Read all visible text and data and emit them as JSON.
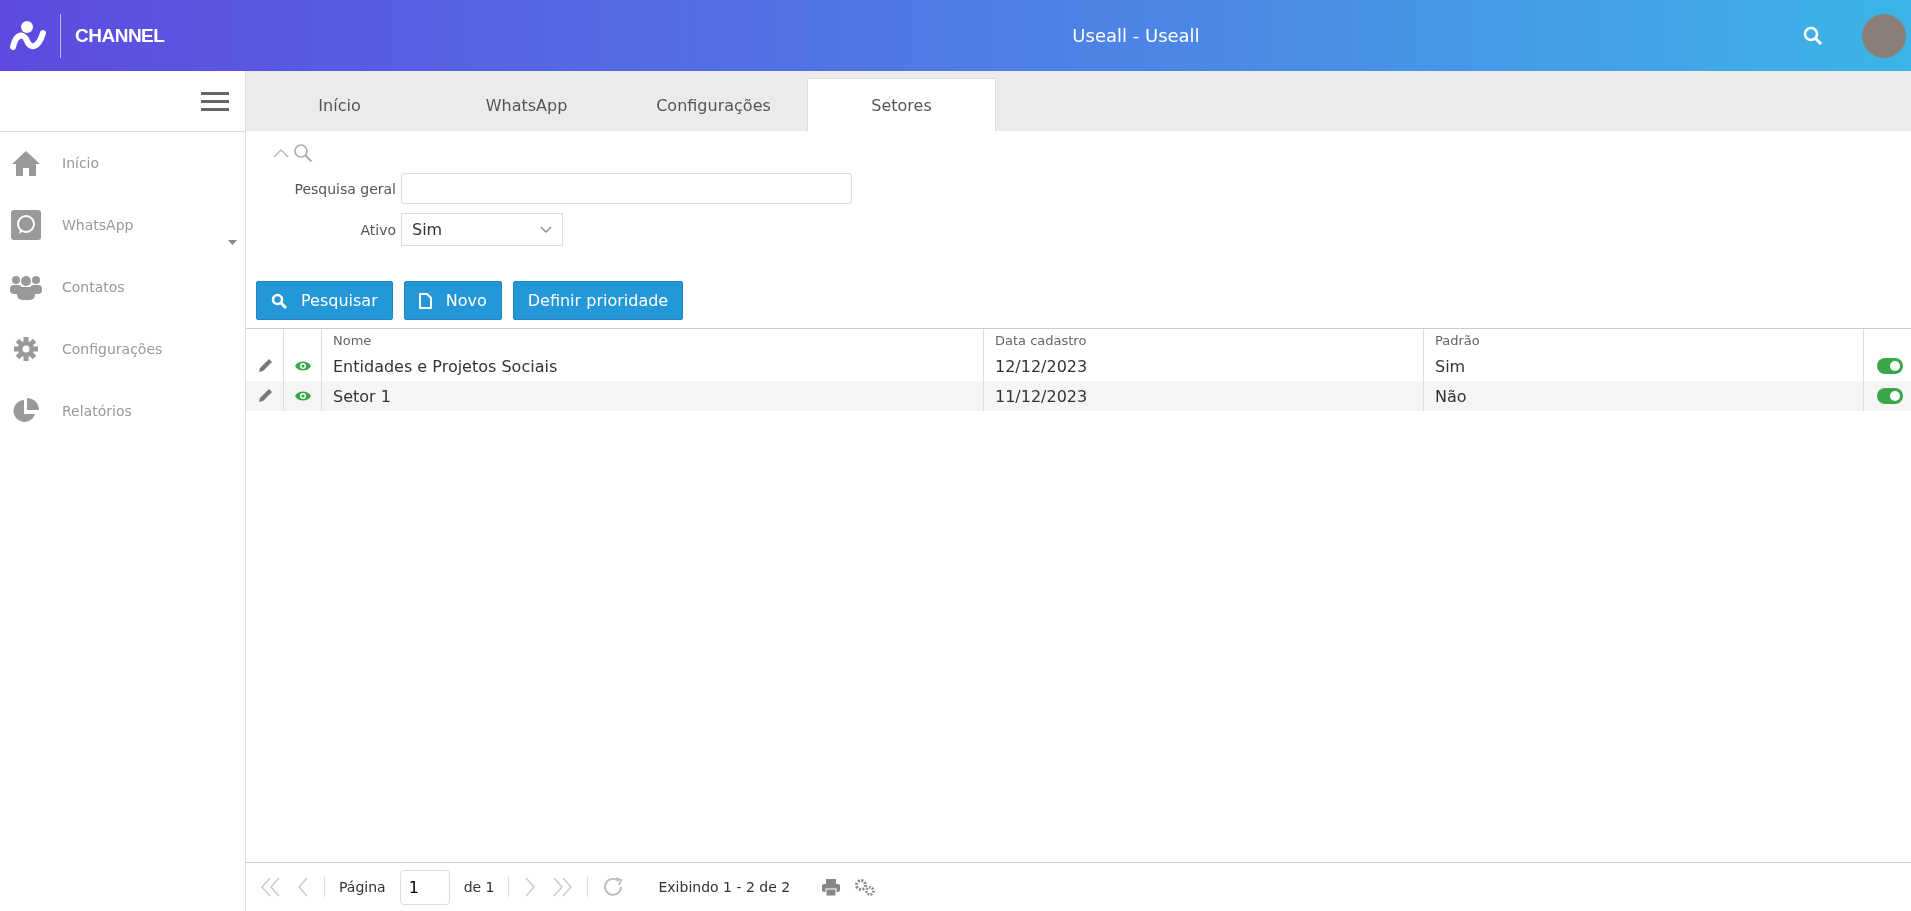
{
  "header": {
    "logo_text": "CHANNEL",
    "title": "Useall - Useall"
  },
  "sidebar": {
    "items": [
      {
        "label": "Início",
        "expanded": false,
        "has_submenu": false
      },
      {
        "label": "WhatsApp",
        "expanded": false,
        "has_submenu": true
      },
      {
        "label": "Contatos",
        "expanded": false,
        "has_submenu": false
      },
      {
        "label": "Configurações",
        "expanded": false,
        "has_submenu": false
      },
      {
        "label": "Relatórios",
        "expanded": false,
        "has_submenu": false
      }
    ]
  },
  "tabs": [
    {
      "label": "Início",
      "selected": false
    },
    {
      "label": "WhatsApp",
      "selected": false
    },
    {
      "label": "Configurações",
      "selected": false
    },
    {
      "label": "Setores",
      "selected": true
    }
  ],
  "filters": {
    "expanded": true,
    "general_search": {
      "label": "Pesquisa geral"
    },
    "active": {
      "label": "Ativo",
      "value": "Sim"
    }
  },
  "buttons": [
    {
      "label": "Pesquisar",
      "kind": "search"
    },
    {
      "label": "Novo",
      "kind": "new"
    },
    {
      "label": "Definir prioridade",
      "kind": "plain"
    }
  ],
  "table": {
    "columns": [
      "Nome",
      "Data cadastro",
      "Padrão"
    ],
    "rows": [
      {
        "cells": [
          "Entidades e Projetos Sociais",
          "12/12/2023",
          "Sim"
        ],
        "on": true
      },
      {
        "cells": [
          "Setor 1",
          "11/12/2023",
          "Não"
        ],
        "on": true
      }
    ]
  },
  "pagination": {
    "page_label": "Página",
    "page": "1",
    "of": "de 1",
    "summary": "Exibindo 1 - 2 de 2"
  }
}
